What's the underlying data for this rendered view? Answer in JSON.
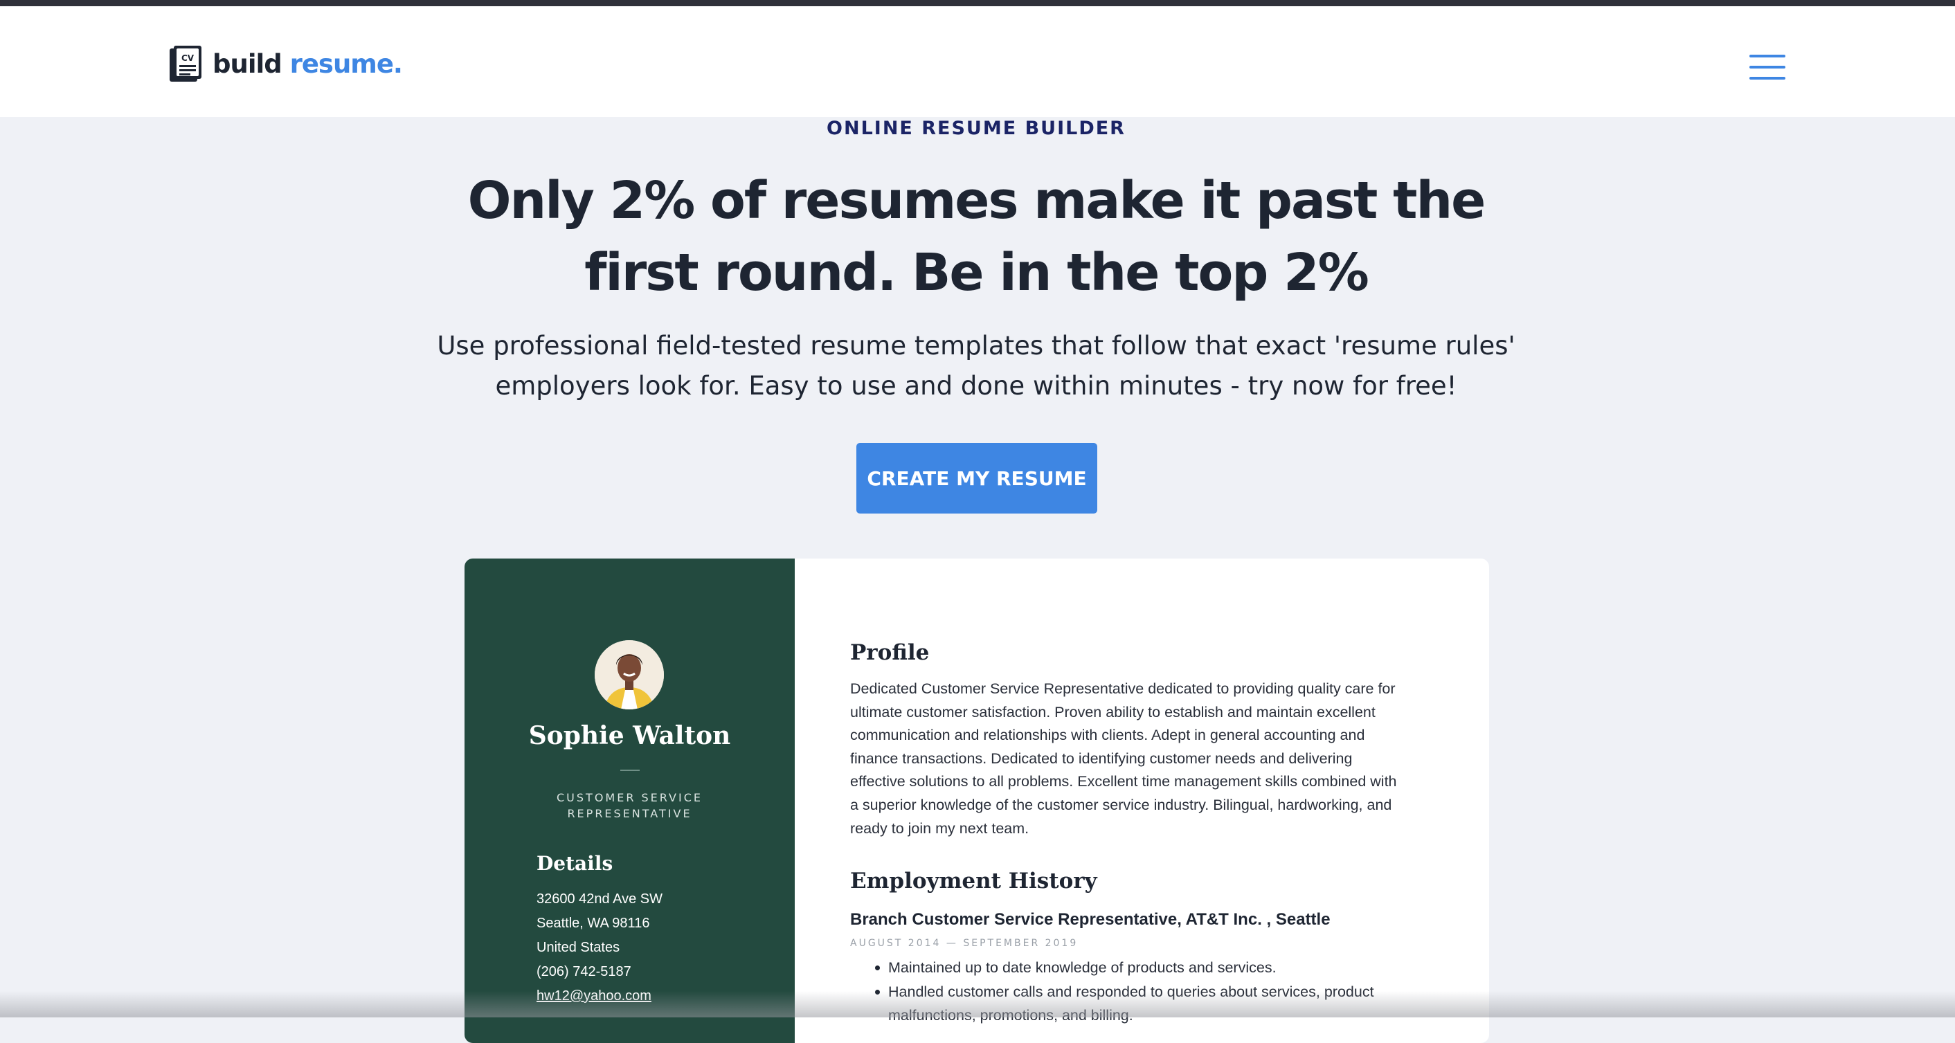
{
  "header": {
    "logo_word": "build",
    "logo_accent": "resume.",
    "logo_icon_text": "CV"
  },
  "hero": {
    "eyebrow": "ONLINE RESUME BUILDER",
    "headline": "Only 2% of resumes make it past the first round. Be in the top 2%",
    "subline": "Use professional field-tested resume templates that follow that exact 'resume rules' employers look for. Easy to use and done within minutes - try now for free!",
    "cta_label": "CREATE MY RESUME"
  },
  "resume": {
    "name": "Sophie Walton",
    "title": "CUSTOMER SERVICE REPRESENTATIVE",
    "details_heading": "Details",
    "details": {
      "address_line1": "32600 42nd Ave SW",
      "address_line2": "Seattle, WA 98116",
      "country": "United States",
      "phone": "(206) 742-5187",
      "email": "hw12@yahoo.com"
    },
    "profile_heading": "Profile",
    "profile_lines": [
      "Dedicated Customer Service Representative dedicated to providing quality care for",
      "ultimate customer satisfaction. Proven ability to establish and maintain excellent",
      "communication and relationships with clients. Adept in general accounting and",
      "finance transactions. Dedicated to identifying customer needs and delivering",
      "effective solutions to all problems. Excellent time management skills combined with",
      "a superior knowledge of the customer service industry. Bilingual, hardworking, and",
      "ready to join my next team."
    ],
    "employment_heading": "Employment History",
    "job_title": "Branch Customer Service Representative, AT&T Inc. , Seattle",
    "job_dates": "AUGUST 2014 — SEPTEMBER 2019",
    "job_bullets": [
      "Maintained up to date knowledge of products and services.",
      "Handled customer calls and responded to queries about services, product",
      "malfunctions, promotions, and billing."
    ]
  },
  "colors": {
    "accent": "#3e86e3",
    "background": "#eff1f6",
    "resume_sidebar": "#234a3f",
    "text_dark": "#1e2532",
    "eyebrow": "#1b2466"
  }
}
